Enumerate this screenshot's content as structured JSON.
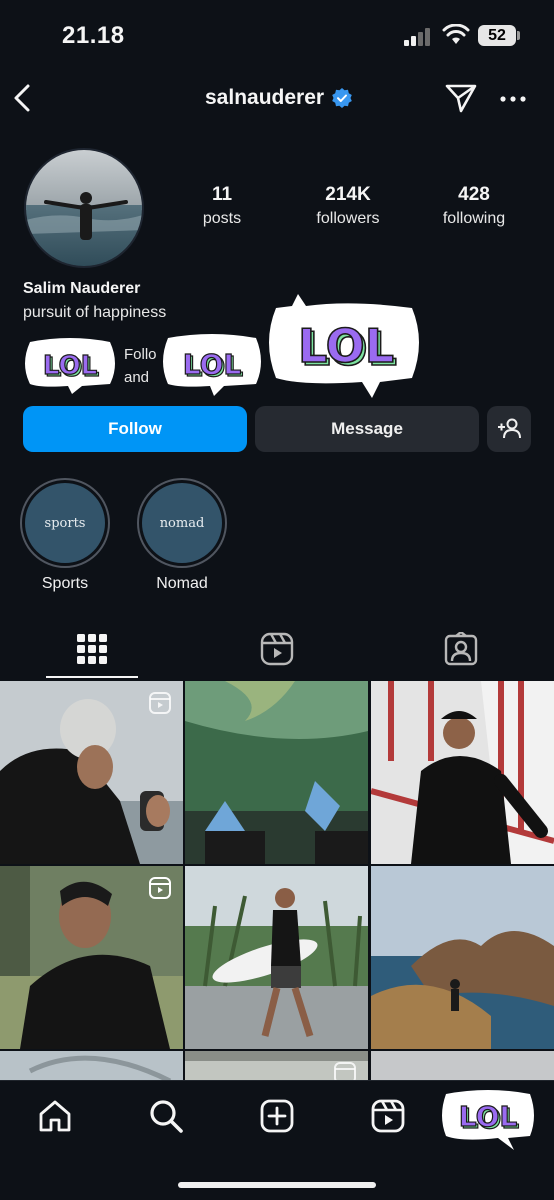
{
  "status_bar": {
    "time": "21.18",
    "battery": "52"
  },
  "header": {
    "username": "salnauderer"
  },
  "profile": {
    "stats": [
      {
        "value": "11",
        "label": "posts"
      },
      {
        "value": "214K",
        "label": "followers"
      },
      {
        "value": "428",
        "label": "following"
      }
    ],
    "name": "Salim Nauderer",
    "bio": "pursuit of happiness",
    "followed_by_line1": "Follo",
    "followed_by_line2": "and"
  },
  "stickers": {
    "text": "LOL"
  },
  "buttons": {
    "follow": "Follow",
    "message": "Message"
  },
  "highlights": [
    {
      "cover_text": "sports",
      "label": "Sports"
    },
    {
      "cover_text": "nomad",
      "label": "Nomad"
    }
  ],
  "tabs": [
    {
      "name": "grid-icon",
      "active": true
    },
    {
      "name": "reels-icon",
      "active": false
    },
    {
      "name": "tagged-icon",
      "active": false
    }
  ],
  "bottom_nav": [
    "home-icon",
    "search-icon",
    "create-icon",
    "reels-icon",
    "profile-avatar"
  ],
  "colors": {
    "accent": "#0095f6",
    "verified": "#3897f0",
    "background": "#0d1117",
    "button_dark": "#262a31",
    "highlight_cover": "#33546a",
    "sticker_purple": "#9a6bf0",
    "sticker_green": "#7de3a0"
  }
}
